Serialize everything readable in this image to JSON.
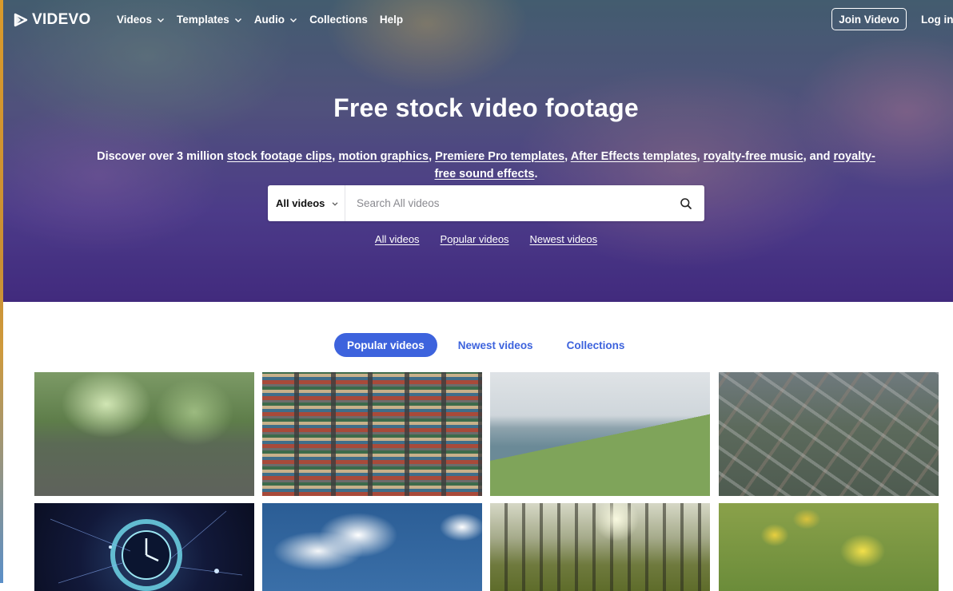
{
  "brand": {
    "name": "VIDEVO"
  },
  "nav": {
    "items": [
      {
        "label": "Videos",
        "dropdown": true
      },
      {
        "label": "Templates",
        "dropdown": true
      },
      {
        "label": "Audio",
        "dropdown": true
      },
      {
        "label": "Collections",
        "dropdown": false
      },
      {
        "label": "Help",
        "dropdown": false
      }
    ],
    "join_label": "Join Videvo",
    "login_label": "Log in"
  },
  "hero": {
    "title": "Free stock video footage",
    "subtitle_parts": [
      {
        "text": "Discover over 3 million ",
        "link": false
      },
      {
        "text": "stock footage clips",
        "link": true
      },
      {
        "text": ", ",
        "link": false
      },
      {
        "text": "motion graphics",
        "link": true
      },
      {
        "text": ", ",
        "link": false
      },
      {
        "text": "Premiere Pro templates",
        "link": true
      },
      {
        "text": ", ",
        "link": false
      },
      {
        "text": "After Effects templates",
        "link": true
      },
      {
        "text": ", ",
        "link": false
      },
      {
        "text": "royalty-free music",
        "link": true
      },
      {
        "text": ", and ",
        "link": false
      },
      {
        "text": "royalty-free sound effects",
        "link": true
      },
      {
        "text": ".",
        "link": false
      }
    ]
  },
  "search": {
    "category": "All videos",
    "placeholder": "Search All videos",
    "value": ""
  },
  "quick_links": [
    "All videos",
    "Popular videos",
    "Newest videos"
  ],
  "tabs": [
    {
      "label": "Popular videos",
      "active": true
    },
    {
      "label": "Newest videos",
      "active": false
    },
    {
      "label": "Collections",
      "active": false
    }
  ],
  "icons": {
    "logo": "play-triangle-icon",
    "dropdown": "chevron-down-icon",
    "search": "search-icon"
  },
  "colors": {
    "accent": "#3d63dd",
    "hero_purple": "#4a2f8c",
    "white": "#ffffff"
  }
}
